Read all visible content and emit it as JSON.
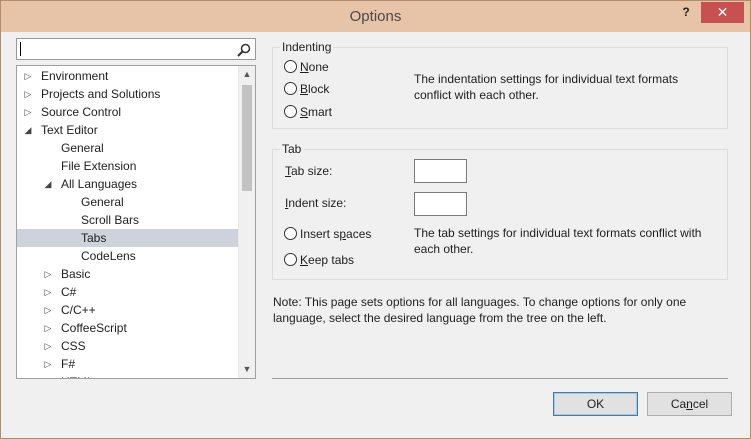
{
  "window": {
    "title": "Options",
    "help_label": "?",
    "close_label": "✕"
  },
  "search": {
    "value": ""
  },
  "tree": {
    "items": [
      {
        "label": "Environment",
        "arrow": "▷",
        "level": 0
      },
      {
        "label": "Projects and Solutions",
        "arrow": "▷",
        "level": 0
      },
      {
        "label": "Source Control",
        "arrow": "▷",
        "level": 0
      },
      {
        "label": "Text Editor",
        "arrow": "◢",
        "level": 0
      },
      {
        "label": "General",
        "arrow": "",
        "level": 1
      },
      {
        "label": "File Extension",
        "arrow": "",
        "level": 1
      },
      {
        "label": "All Languages",
        "arrow": "◢",
        "level": 1
      },
      {
        "label": "General",
        "arrow": "",
        "level": 2
      },
      {
        "label": "Scroll Bars",
        "arrow": "",
        "level": 2
      },
      {
        "label": "Tabs",
        "arrow": "",
        "level": 2,
        "selected": true
      },
      {
        "label": "CodeLens",
        "arrow": "",
        "level": 2
      },
      {
        "label": "Basic",
        "arrow": "▷",
        "level": 1
      },
      {
        "label": "C#",
        "arrow": "▷",
        "level": 1
      },
      {
        "label": "C/C++",
        "arrow": "▷",
        "level": 1
      },
      {
        "label": "CoffeeScript",
        "arrow": "▷",
        "level": 1
      },
      {
        "label": "CSS",
        "arrow": "▷",
        "level": 1
      },
      {
        "label": "F#",
        "arrow": "▷",
        "level": 1
      },
      {
        "label": "HTML",
        "arrow": "▷",
        "level": 1
      }
    ]
  },
  "indenting": {
    "title": "Indenting",
    "none_u": "N",
    "none_rest": "one",
    "block_u": "B",
    "block_rest": "lock",
    "smart_u": "S",
    "smart_rest": "mart",
    "info": "The indentation settings for individual text formats conflict with each other."
  },
  "tab": {
    "title": "Tab",
    "tab_size_u": "T",
    "tab_size_rest": "ab size:",
    "tab_size_value": "",
    "indent_size_u": "I",
    "indent_size_rest": "ndent size:",
    "indent_size_value": "",
    "insert_spaces_pre": "Insert s",
    "insert_spaces_u": "p",
    "insert_spaces_post": "aces",
    "keep_tabs_u": "K",
    "keep_tabs_rest": "eep tabs",
    "info": "The tab settings for individual text formats conflict with each other."
  },
  "note": "Note: This page sets options for all languages. To change options for only one language, select the desired language from the tree on the left.",
  "buttons": {
    "ok": "OK",
    "cancel_pre": "Ca",
    "cancel_u": "n",
    "cancel_post": "cel"
  }
}
